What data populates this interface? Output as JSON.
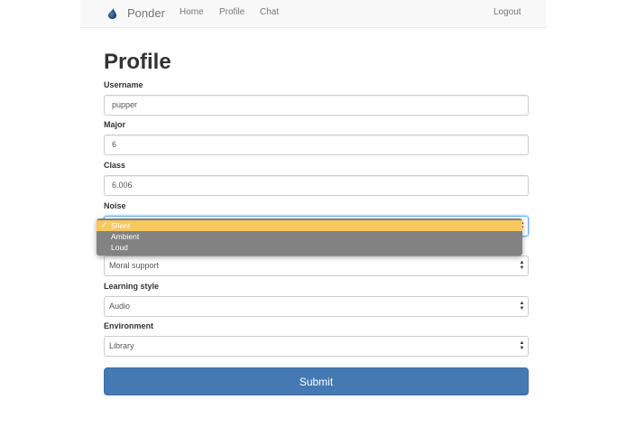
{
  "navbar": {
    "brand": "Ponder",
    "links": [
      "Home",
      "Profile",
      "Chat"
    ],
    "logout": "Logout"
  },
  "page": {
    "title": "Profile"
  },
  "form": {
    "username": {
      "label": "Username",
      "value": "pupper"
    },
    "major": {
      "label": "Major",
      "value": "6"
    },
    "class": {
      "label": "Class",
      "value": "6.006"
    },
    "noise": {
      "label": "Noise",
      "options": [
        "Silent",
        "Ambient",
        "Loud"
      ],
      "selected": "Silent",
      "dropdown_open": true
    },
    "support": {
      "value": "Moral support"
    },
    "learning_style": {
      "label": "Learning style",
      "value": "Audio"
    },
    "environment": {
      "label": "Environment",
      "value": "Library"
    },
    "submit_label": "Submit"
  },
  "icons": {
    "brand": "droplet-icon",
    "select": "select-arrows-icon",
    "check": "checkmark-icon"
  },
  "colors": {
    "primary_button": "#4479b4",
    "dropdown_highlight": "#f8c85a",
    "dropdown_bg": "#828282",
    "navbar_bg": "#f8f8f8"
  }
}
